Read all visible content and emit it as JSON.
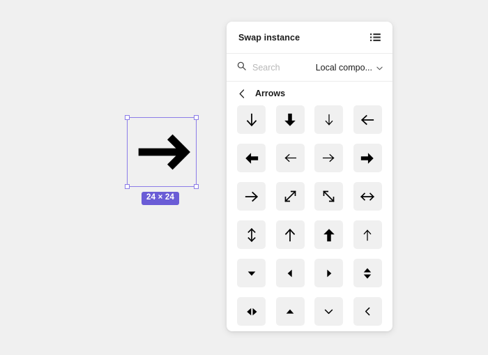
{
  "canvas": {
    "selection": {
      "size_badge": "24 × 24",
      "badge_color": "#6a5cd6",
      "outline_color": "#8b7ce8",
      "shape_name": "arrow-right"
    }
  },
  "panel": {
    "title": "Swap instance",
    "list_view_icon": "list-view-icon",
    "search": {
      "placeholder": "Search",
      "value": "",
      "icon": "search-icon"
    },
    "source_filter": {
      "label": "Local compo...",
      "chevron_icon": "chevron-down-icon"
    },
    "breadcrumb": {
      "back_icon": "chevron-left-icon",
      "label": "Arrows"
    },
    "grid": {
      "items": [
        {
          "name": "arrow-down-thin",
          "glyph": "arrow-down-thin"
        },
        {
          "name": "arrow-down-bold",
          "glyph": "arrow-down-bold"
        },
        {
          "name": "arrow-down-light",
          "glyph": "arrow-down-light"
        },
        {
          "name": "arrow-left-thin",
          "glyph": "arrow-left-thin"
        },
        {
          "name": "arrow-left-bold",
          "glyph": "arrow-left-bold"
        },
        {
          "name": "arrow-left-light",
          "glyph": "arrow-left-light"
        },
        {
          "name": "arrow-right-light",
          "glyph": "arrow-right-light"
        },
        {
          "name": "arrow-right-bold",
          "glyph": "arrow-right-bold"
        },
        {
          "name": "arrow-right-thin",
          "glyph": "arrow-right-thin"
        },
        {
          "name": "arrow-expand-diagonal",
          "glyph": "arrow-expand-diagonal"
        },
        {
          "name": "arrow-collapse-diagonal",
          "glyph": "arrow-collapse-diagonal"
        },
        {
          "name": "arrow-left-right",
          "glyph": "arrow-left-right"
        },
        {
          "name": "arrow-up-down",
          "glyph": "arrow-up-down"
        },
        {
          "name": "arrow-up-thin",
          "glyph": "arrow-up-thin"
        },
        {
          "name": "arrow-up-bold",
          "glyph": "arrow-up-bold"
        },
        {
          "name": "arrow-up-light",
          "glyph": "arrow-up-light"
        },
        {
          "name": "triangle-down",
          "glyph": "triangle-down"
        },
        {
          "name": "triangle-left",
          "glyph": "triangle-left"
        },
        {
          "name": "triangle-right",
          "glyph": "triangle-right"
        },
        {
          "name": "sort-triangles-vertical",
          "glyph": "sort-triangles-vertical"
        },
        {
          "name": "sort-triangles-horizontal",
          "glyph": "sort-triangles-horizontal"
        },
        {
          "name": "triangle-up",
          "glyph": "triangle-up"
        },
        {
          "name": "chevron-down",
          "glyph": "chevron-down"
        },
        {
          "name": "chevron-left",
          "glyph": "chevron-left"
        }
      ]
    }
  },
  "colors": {
    "background": "#f0f0f0",
    "panel_background": "#ffffff",
    "cell_background": "#f0f0f0",
    "text_primary": "#1a1a1a",
    "text_placeholder": "#b8b8b8",
    "accent_purple": "#6a5cd6"
  }
}
